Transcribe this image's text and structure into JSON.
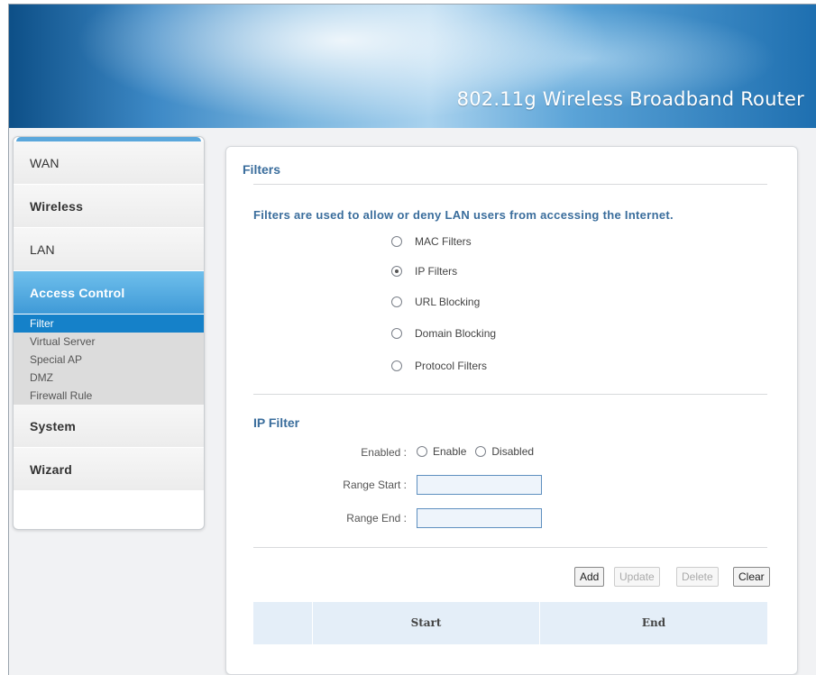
{
  "header": {
    "title": "802.11g Wireless Broadband Router"
  },
  "sidebar": {
    "items": [
      {
        "label": "WAN"
      },
      {
        "label": "Wireless"
      },
      {
        "label": "LAN"
      },
      {
        "label": "Access Control"
      },
      {
        "label": "System"
      },
      {
        "label": "Wizard"
      }
    ],
    "sub_items": [
      {
        "label": "Filter"
      },
      {
        "label": "Virtual Server"
      },
      {
        "label": "Special AP"
      },
      {
        "label": "DMZ"
      },
      {
        "label": "Firewall Rule"
      }
    ]
  },
  "filters": {
    "title": "Filters",
    "description": "Filters are used to allow or deny LAN users from accessing the Internet.",
    "options": [
      {
        "label": "MAC Filters",
        "selected": false
      },
      {
        "label": "IP Filters",
        "selected": true
      },
      {
        "label": "URL Blocking",
        "selected": false
      },
      {
        "label": "Domain Blocking",
        "selected": false
      },
      {
        "label": "Protocol Filters",
        "selected": false
      }
    ]
  },
  "ip_filter": {
    "title": "IP Filter",
    "enabled_label": "Enabled :",
    "enable_option": "Enable",
    "disabled_option": "Disabled",
    "range_start_label": "Range Start :",
    "range_start_value": "",
    "range_end_label": "Range End :",
    "range_end_value": ""
  },
  "buttons": {
    "add": "Add",
    "update": "Update",
    "delete": "Delete",
    "clear": "Clear"
  },
  "table": {
    "columns": [
      "",
      "Start",
      "End"
    ]
  }
}
